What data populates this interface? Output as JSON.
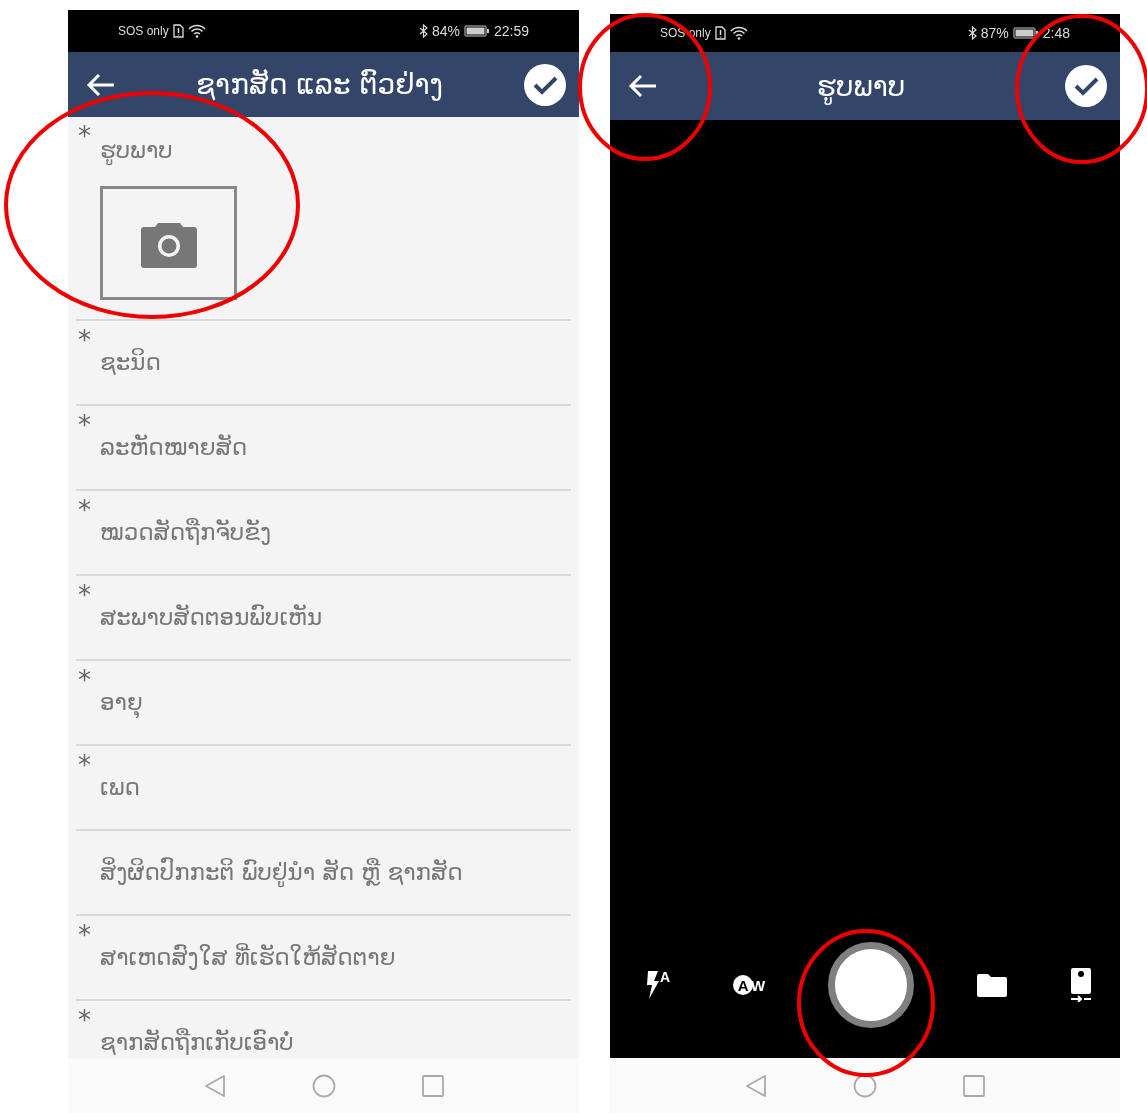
{
  "screens": [
    {
      "kind": "form",
      "status_bar": {
        "carrier": "SOS only",
        "battery": "84%",
        "time": "22:59"
      },
      "header": {
        "title": "ຊາກສັດ ແລະ ຕົວຢ່າງ"
      },
      "fields": [
        {
          "kind": "photo",
          "marker": "*",
          "label": "ຮູບພາບ"
        },
        {
          "kind": "text",
          "marker": "*",
          "label": "ຊະນິດ"
        },
        {
          "kind": "text",
          "marker": "*",
          "label": "ລະຫັດໝາຍສັດ"
        },
        {
          "kind": "text",
          "marker": "*",
          "label": "ໝວດສັດຖືກຈັບຂັງ"
        },
        {
          "kind": "text",
          "marker": "*",
          "label": "ສະພາບສັດຕອນພົບເຫັນ"
        },
        {
          "kind": "text",
          "marker": "*",
          "label": "ອາຍຸ"
        },
        {
          "kind": "text",
          "marker": "*",
          "label": "ເພດ"
        },
        {
          "kind": "text",
          "label": "ສິ່ງຜິດປົກກະຕິ ພົບຢູ່ນຳ ສັດ ຫຼື ຊາກສັດ"
        },
        {
          "kind": "text",
          "marker": "*",
          "label": "ສາເຫດສົງໃສ ທີ່ເຮັດໃຫ້ສັດຕາຍ"
        },
        {
          "kind": "text",
          "marker": "*",
          "label": "ຊາກສັດຖືກເກັບເອົາບໍ່"
        }
      ]
    },
    {
      "kind": "camera",
      "status_bar": {
        "carrier": "SOS only",
        "battery": "87%",
        "time": "2:48"
      },
      "header": {
        "title": "ຮູບພາບ"
      },
      "controls": {
        "flash_label": "A",
        "white_balance_labels": [
          "A",
          "W"
        ]
      }
    }
  ],
  "annotations": [
    {
      "kind": "circle"
    },
    {
      "kind": "circle"
    },
    {
      "kind": "circle"
    },
    {
      "kind": "circle"
    }
  ]
}
